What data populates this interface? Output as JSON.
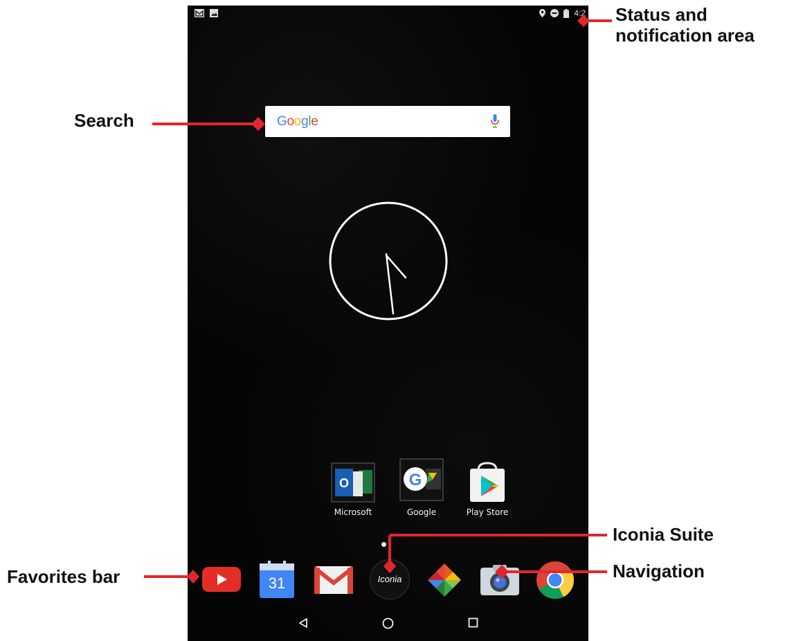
{
  "statusbar": {
    "left_icons": [
      "gmail-notification-icon",
      "image-notification-icon"
    ],
    "right_icons": [
      "location-icon",
      "do-not-disturb-icon",
      "battery-icon"
    ],
    "time": "4:2"
  },
  "search": {
    "logo": [
      "G",
      "o",
      "o",
      "g",
      "l",
      "e"
    ],
    "mic_icon": "mic-icon"
  },
  "apps": [
    {
      "label": "Microsoft",
      "icon": "microsoft-folder-icon"
    },
    {
      "label": "Google",
      "icon": "google-folder-icon"
    },
    {
      "label": "Play Store",
      "icon": "play-store-icon"
    }
  ],
  "dock": [
    {
      "name": "youtube-icon"
    },
    {
      "name": "calendar-icon",
      "text": "31"
    },
    {
      "name": "gmail-icon"
    },
    {
      "name": "iconia-icon",
      "text": "Iconia"
    },
    {
      "name": "photos-icon"
    },
    {
      "name": "camera-icon"
    },
    {
      "name": "chrome-icon"
    }
  ],
  "nav": [
    "back-icon",
    "home-icon",
    "recents-icon"
  ],
  "callouts": {
    "status": "Status and notification area",
    "status_line1": "Status and",
    "status_line2": "notification area",
    "search": "Search",
    "iconia": "Iconia Suite",
    "favorites": "Favorites bar",
    "navigation": "Navigation"
  },
  "colors": {
    "callout_red": "#E3262D",
    "screen_bg": "#050505"
  }
}
